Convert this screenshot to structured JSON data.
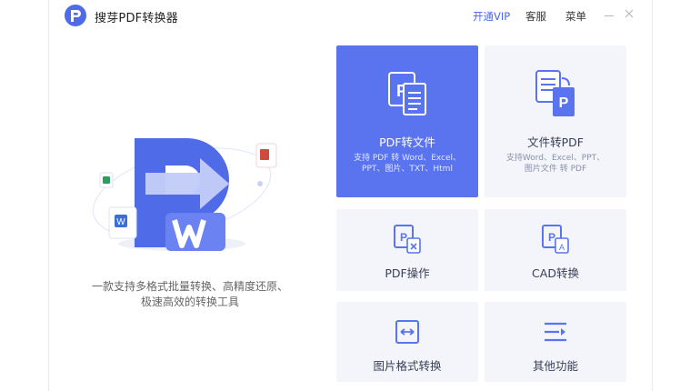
{
  "app": {
    "title": "搜芽PDF转换器"
  },
  "toolbar": {
    "vip": "开通VIP",
    "service": "客服",
    "menu": "菜单"
  },
  "hero": {
    "tagline_line1": "一款支持多格式批量转换、高精度还原、",
    "tagline_line2": "极速高效的转换工具"
  },
  "tiles": [
    {
      "label": "PDF转文件",
      "desc_line1": "支持 PDF 转 Word、Excel、",
      "desc_line2": "PPT、图片、TXT、Html",
      "icon": "pdf-to-file-icon",
      "active": true
    },
    {
      "label": "文件转PDF",
      "desc_line1": "支持Word、Excel、PPT、",
      "desc_line2": "图片文件 转 PDF",
      "icon": "file-to-pdf-icon",
      "active": false
    },
    {
      "label": "PDF操作",
      "icon": "pdf-operation-icon",
      "active": false
    },
    {
      "label": "CAD转换",
      "icon": "cad-convert-icon",
      "active": false
    },
    {
      "label": "图片格式转换",
      "icon": "image-convert-icon",
      "active": false
    },
    {
      "label": "其他功能",
      "icon": "other-functions-icon",
      "active": false
    }
  ],
  "colors": {
    "accent": "#5a73ee",
    "tile_bg": "#f3f5fb",
    "vip": "#4a66e8"
  }
}
